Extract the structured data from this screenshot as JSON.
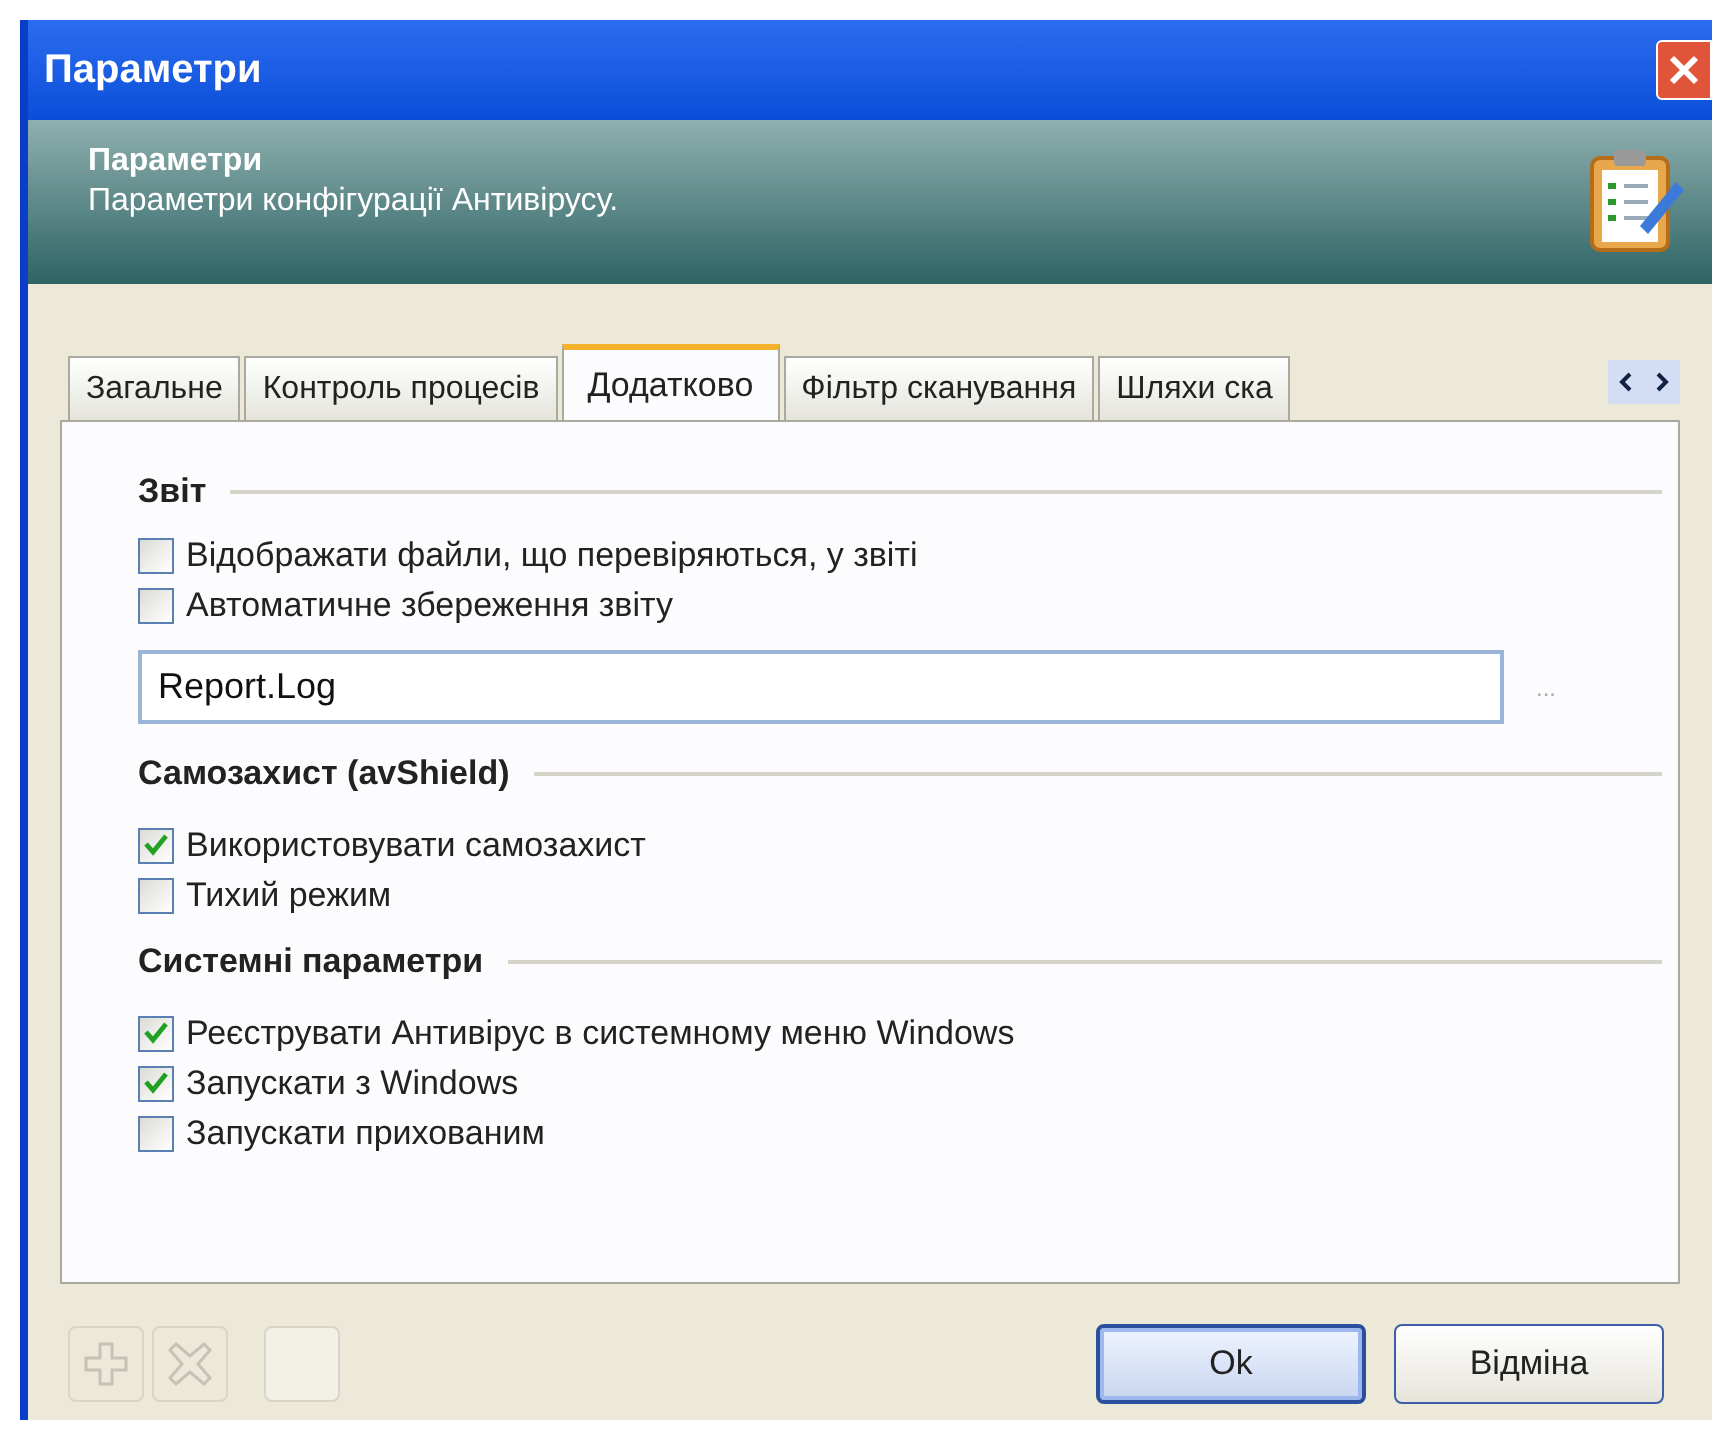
{
  "window": {
    "title": "Параметри"
  },
  "header": {
    "title": "Параметри",
    "subtitle": "Параметри конфігурації Антивірусу."
  },
  "tabs": [
    {
      "label": "Загальне",
      "selected": false
    },
    {
      "label": "Контроль процесів",
      "selected": false
    },
    {
      "label": "Додатково",
      "selected": true
    },
    {
      "label": "Фільтр сканування",
      "selected": false
    },
    {
      "label": "Шляхи ска",
      "selected": false
    }
  ],
  "sections": [
    {
      "title": "Звіт",
      "items": [
        {
          "kind": "checkbox",
          "label": "Відображати файли, що перевіряються, у звіті",
          "checked": false
        },
        {
          "kind": "checkbox",
          "label": "Автоматичне збереження звіту",
          "checked": false
        },
        {
          "kind": "field",
          "value": "Report.Log",
          "button": "..."
        }
      ]
    },
    {
      "title": "Самозахист (avShield)",
      "items": [
        {
          "kind": "checkbox",
          "label": "Використовувати самозахист",
          "checked": true
        },
        {
          "kind": "checkbox",
          "label": "Тихий режим",
          "checked": false
        }
      ]
    },
    {
      "title": "Системні параметри",
      "items": [
        {
          "kind": "checkbox",
          "label": "Реєструвати Антивірус в системному меню Windows",
          "checked": true
        },
        {
          "kind": "checkbox",
          "label": "Запускати з Windows",
          "checked": true
        },
        {
          "kind": "checkbox",
          "label": "Запускати прихованим",
          "checked": false
        }
      ]
    }
  ],
  "buttons": [
    {
      "label": "Ok",
      "selected": true
    },
    {
      "label": "Відміна",
      "selected": false
    }
  ]
}
